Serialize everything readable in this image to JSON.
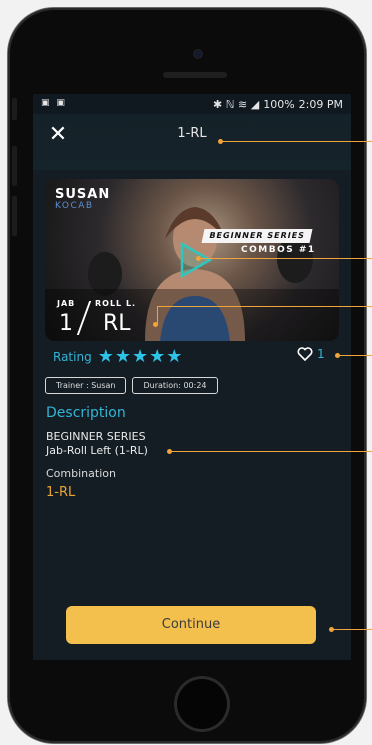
{
  "status_bar": {
    "left_icons": "▣ ▣",
    "right_text": "✱ ℕ ⌇ 📶 100% 2:09 PM",
    "battery": "100%",
    "time": "2:09 PM"
  },
  "header": {
    "title": "1-RL",
    "close_icon": "close-icon"
  },
  "hero": {
    "trainer_first": "SUSAN",
    "trainer_last": "KOCAB",
    "series_tag": "BEGINNER SERIES",
    "combo_tag": "COMBOS #1",
    "move1_label": "JAB",
    "move1_value": "1",
    "move2_label": "ROLL L.",
    "move2_value": "RL"
  },
  "rating": {
    "label": "Rating",
    "stars": 5
  },
  "like": {
    "count": "1"
  },
  "chips": {
    "trainer": "Trainer : Susan",
    "duration": "Duration: 00:24"
  },
  "description": {
    "heading": "Description",
    "line1": "BEGINNER SERIES",
    "line2": "Jab-Roll Left (1-RL)"
  },
  "combination": {
    "heading": "Combination",
    "value": "1-RL"
  },
  "footer": {
    "continue_label": "Continue"
  },
  "colors": {
    "accent": "#33b4d6",
    "button": "#f3c04d",
    "callout": "#f0a43a",
    "combo": "#e9a536"
  }
}
